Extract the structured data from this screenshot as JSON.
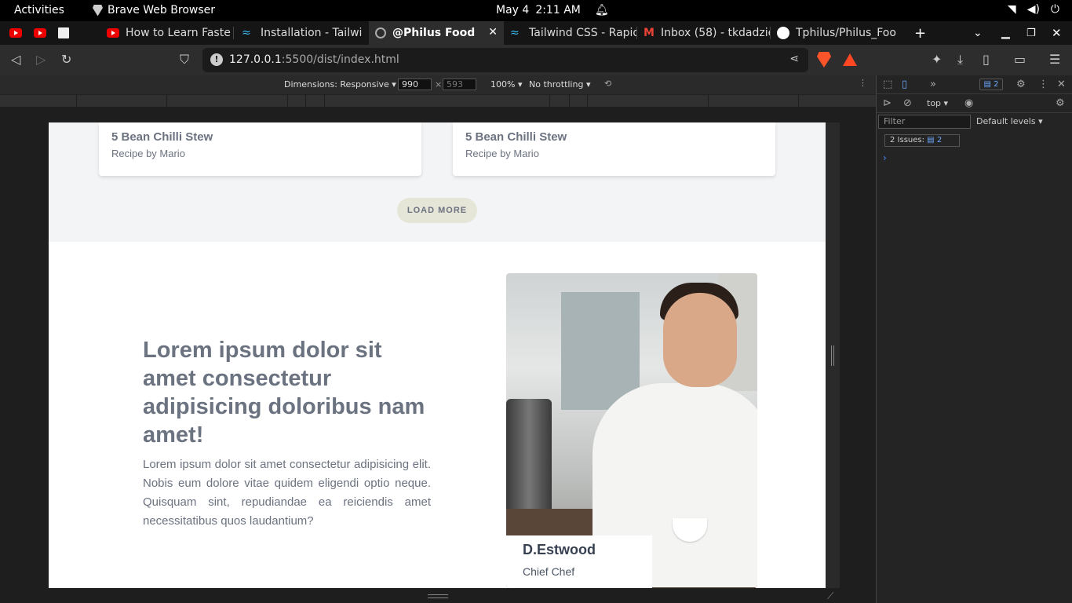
{
  "system": {
    "activities": "Activities",
    "app_name": "Brave Web Browser",
    "date": "May 4",
    "time": "2:11 AM"
  },
  "tabs": [
    {
      "label": "",
      "icon": "youtube-icon"
    },
    {
      "label": "",
      "icon": "youtube-icon"
    },
    {
      "label": "",
      "icon": "document-icon"
    },
    {
      "label": "How to Learn Faste",
      "icon": "youtube-icon"
    },
    {
      "label": "Installation - Tailwi",
      "icon": "tailwind-icon"
    },
    {
      "label": "@Philus Food",
      "icon": "globe-icon",
      "active": true
    },
    {
      "label": "Tailwind CSS - Rapid",
      "icon": "tailwind-icon"
    },
    {
      "label": "Inbox (58) - tkdadzie",
      "icon": "gmail-icon"
    },
    {
      "label": "Tphilus/Philus_Foo",
      "icon": "github-icon"
    }
  ],
  "address": {
    "host": "127.0.0.1",
    "path": ":5500/dist/index.html"
  },
  "device_toolbar": {
    "dimensions_label": "Dimensions: Responsive ▾",
    "width": "990",
    "height": "593",
    "zoom": "100% ▾",
    "throttling": "No throttling ▾"
  },
  "page": {
    "cards": [
      {
        "title": "5 Bean Chilli Stew",
        "subtitle": "Recipe by Mario"
      },
      {
        "title": "5 Bean Chilli Stew",
        "subtitle": "Recipe by Mario"
      }
    ],
    "load_more": "LOAD MORE",
    "headline": "Lorem ipsum dolor sit amet consectetur adipisicing doloribus nam amet!",
    "paragraph": "Lorem ipsum dolor sit amet consectetur adipisicing elit. Nobis eum dolore vitae quidem eligendi optio neque. Quisquam sint, repudiandae ea reiciendis amet necessitatibus quos laudantium?",
    "chef_name": "D.Estwood",
    "chef_role": "Chief Chef"
  },
  "devtools": {
    "issues_badge": "2",
    "context": "top ▾",
    "filter_placeholder": "Filter",
    "levels": "Default levels ▾",
    "issues_label": "2 Issues:",
    "issues_count": "2"
  }
}
